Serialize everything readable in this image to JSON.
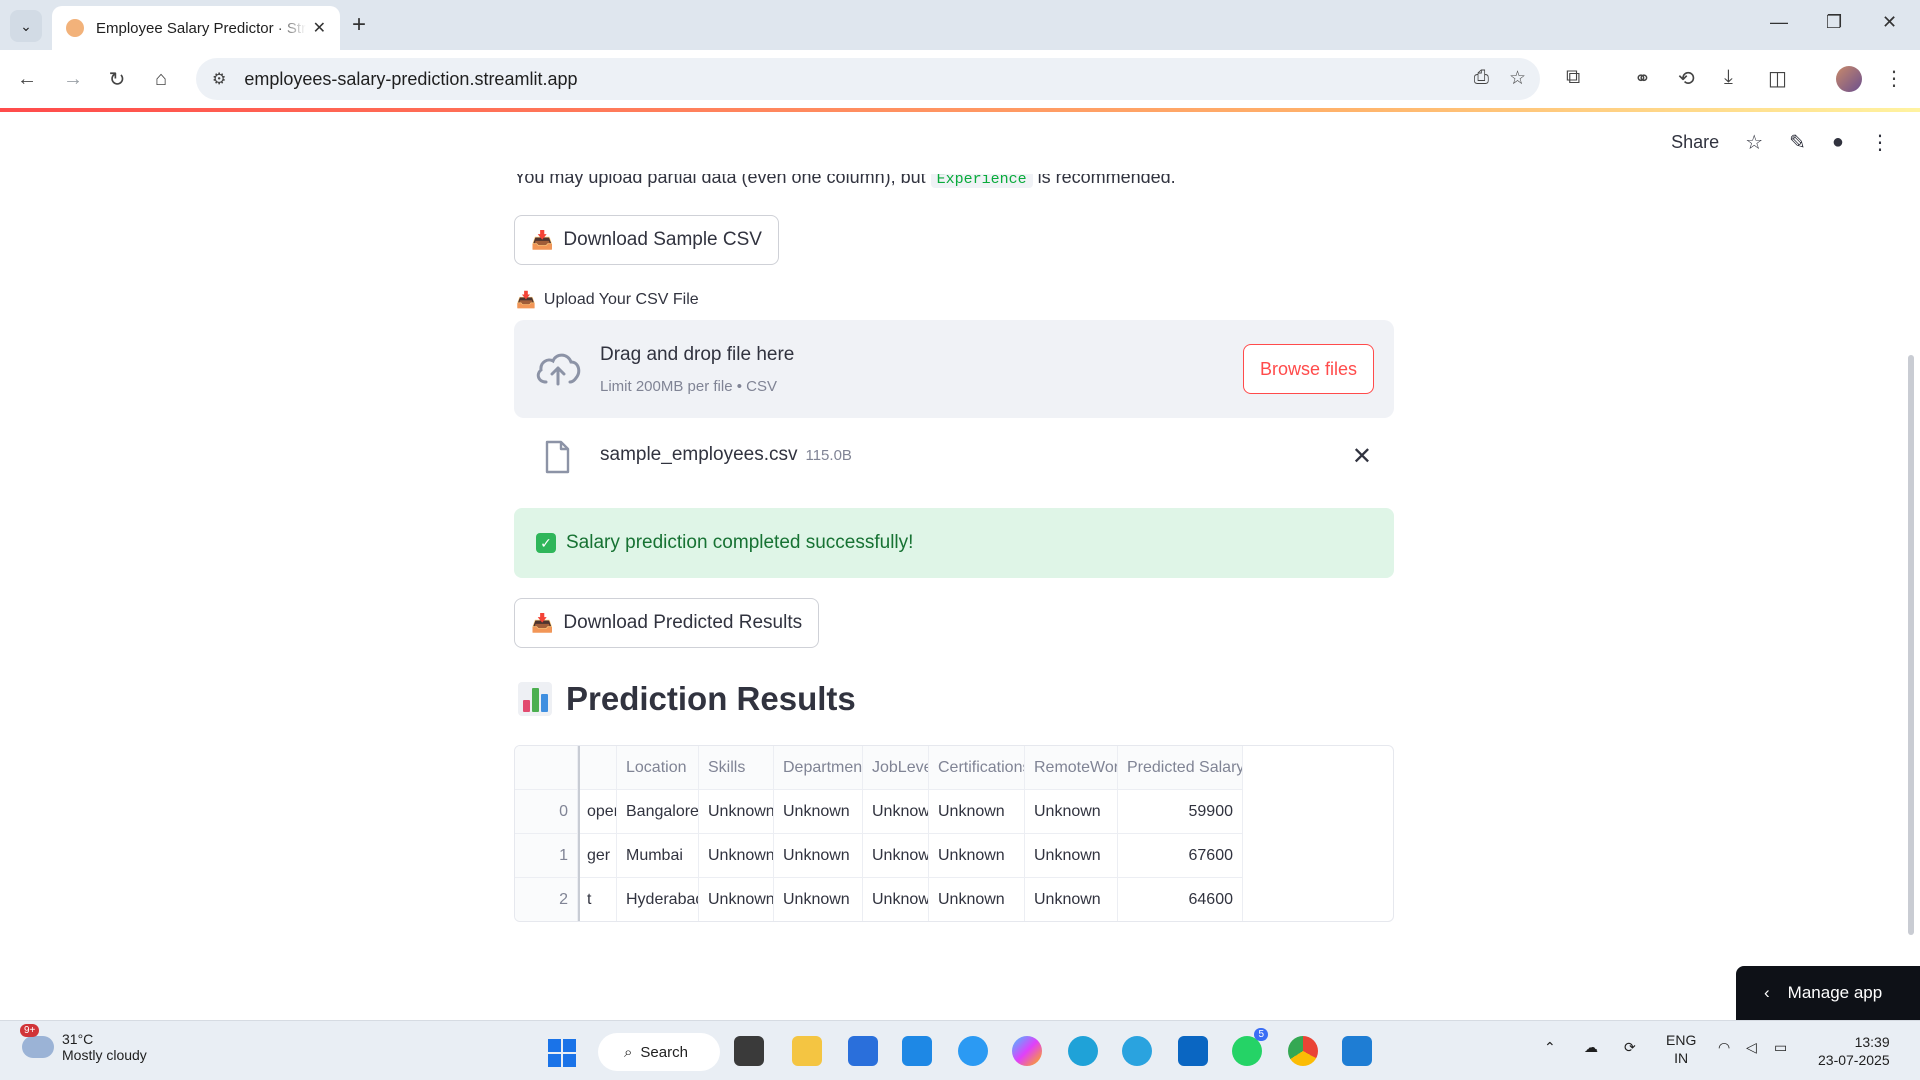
{
  "browser": {
    "tab_title": "Employee Salary Predictor · Streamlit",
    "url": "employees-salary-prediction.streamlit.app"
  },
  "header": {
    "share_label": "Share"
  },
  "main": {
    "partial_text_before": "You may upload partial data (even one column), but ",
    "partial_code": "Experience",
    "partial_text_after": " is recommended.",
    "download_sample_label": "Download Sample CSV",
    "upload_label": "Upload Your CSV File",
    "dropzone": {
      "title": "Drag and drop file here",
      "subtitle": "Limit 200MB per file • CSV",
      "browse_label": "Browse files"
    },
    "uploaded_file": {
      "name": "sample_employees.csv",
      "size": "115.0B"
    },
    "success_message": "Salary prediction completed successfully!",
    "download_results_label": "Download Predicted Results",
    "results_title": "Prediction Results"
  },
  "table": {
    "columns": [
      "Location",
      "Skills",
      "Department",
      "JobLevel",
      "Certifications",
      "RemoteWork",
      "Predicted Salary"
    ],
    "rows": [
      {
        "index": "0",
        "partial": "oper",
        "cells": [
          "Bangalore",
          "Unknown",
          "Unknown",
          "Unknown",
          "Unknown",
          "Unknown",
          "59900"
        ]
      },
      {
        "index": "1",
        "partial": "ger",
        "cells": [
          "Mumbai",
          "Unknown",
          "Unknown",
          "Unknown",
          "Unknown",
          "Unknown",
          "67600"
        ]
      },
      {
        "index": "2",
        "partial": "t",
        "cells": [
          "Hyderabad",
          "Unknown",
          "Unknown",
          "Unknown",
          "Unknown",
          "Unknown",
          "64600"
        ]
      }
    ]
  },
  "manage_app_label": "Manage app",
  "taskbar": {
    "weather_badge": "9+",
    "temperature": "31°C",
    "weather": "Mostly cloudy",
    "search_label": "Search",
    "whatsapp_badge": "5",
    "lang_top": "ENG",
    "lang_bottom": "IN",
    "time": "13:39",
    "date": "23-07-2025"
  }
}
